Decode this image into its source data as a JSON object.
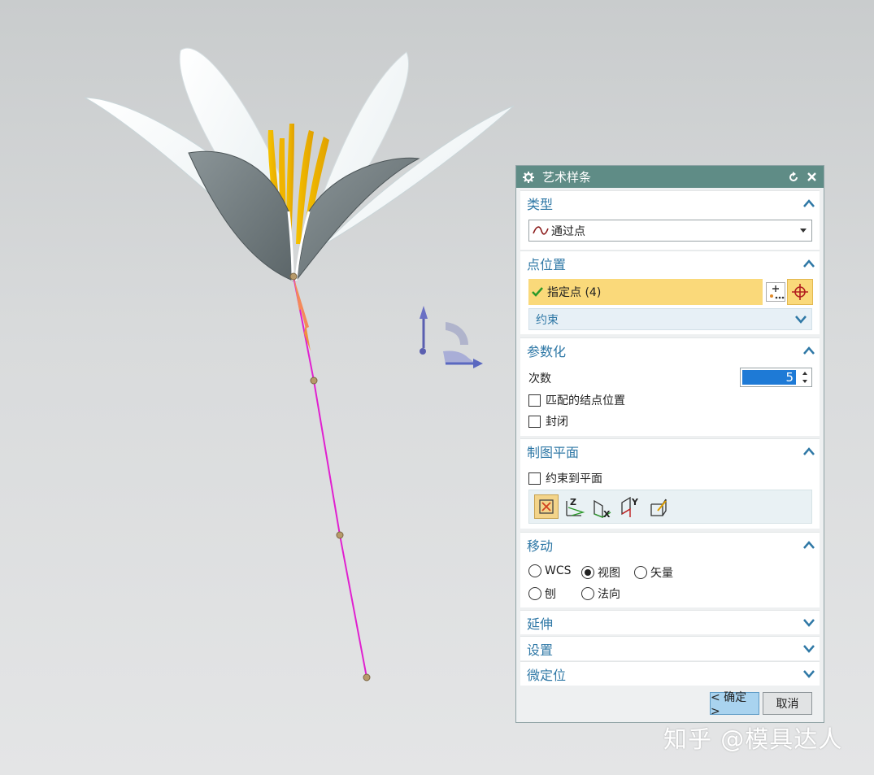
{
  "dialog": {
    "title": "艺术样条",
    "type_group": {
      "header": "类型",
      "selected": "通过点"
    },
    "points_group": {
      "header": "点位置",
      "specify_point": "指定点 (4)",
      "constraint": "约束"
    },
    "param_group": {
      "header": "参数化",
      "degree_label": "次数",
      "degree_value": "5",
      "match_knots": "匹配的结点位置",
      "closed": "封闭"
    },
    "plane_group": {
      "header": "制图平面",
      "constrain_to_plane": "约束到平面"
    },
    "move_group": {
      "header": "移动",
      "wcs": "WCS",
      "view": "视图",
      "vector": "矢量",
      "plane": "刨",
      "normal": "法向",
      "selected": "视图"
    },
    "extend_group": {
      "header": "延伸"
    },
    "settings_group": {
      "header": "设置"
    },
    "fine_group": {
      "header": "微定位"
    },
    "ok_label": "< 确定 >",
    "cancel_label": "取消"
  },
  "colors": {
    "title_bar": "#5f8c86",
    "group_header": "#2f78a6",
    "highlight_row": "#fad97a",
    "spline": "#e020d0",
    "degree_field": "#1e7ad6"
  },
  "watermark": "知乎 @模具达人"
}
